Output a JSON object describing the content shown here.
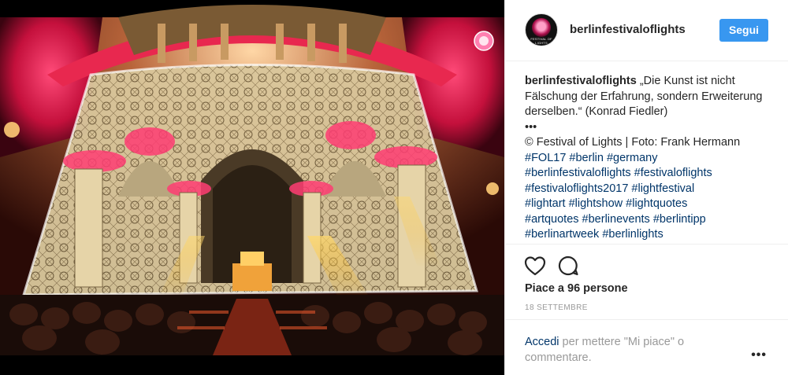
{
  "post": {
    "username": "berlinfestivaloflights",
    "follow_label": "Segui",
    "avatar_text": "FESTIVAL OF LIGHTS",
    "caption": {
      "username": "berlinfestivaloflights",
      "quote": " „Die Kunst ist nicht Fälschung der Erfahrung, sondern Erweiterung derselben.“ (Konrad Fiedler)",
      "dots": "•••",
      "credit": "© Festival of Lights | Foto: Frank Hermann",
      "tags_line1": "#FOL17 #berlin #germany",
      "tags_line2": "#berlinfestivaloflights #festivaloflights",
      "tags_line3": "#festivaloflights2017 #lightfestival",
      "tags_line4": "#lightart #lightshow #lightquotes",
      "tags_line5": "#artquotes #berlinevents #berlintipp",
      "tags_line6": "#berlinartweek #berlinlights"
    },
    "likes": "Piace a 96 persone",
    "date": "18 SETTEMBRE",
    "comment_prompt": {
      "link": "Accedi",
      "rest": " per mettere \"Mi piace\" o commentare."
    },
    "more_label": "•••",
    "photo_watermark": "FESTIVAL OF LIGHTS"
  },
  "icons": {
    "heart": "heart-icon",
    "comment": "comment-icon",
    "more": "more-options-icon"
  },
  "colors": {
    "follow_button": "#3897f0",
    "hashtag": "#003569",
    "muted": "#999999",
    "divider": "#efefef"
  }
}
